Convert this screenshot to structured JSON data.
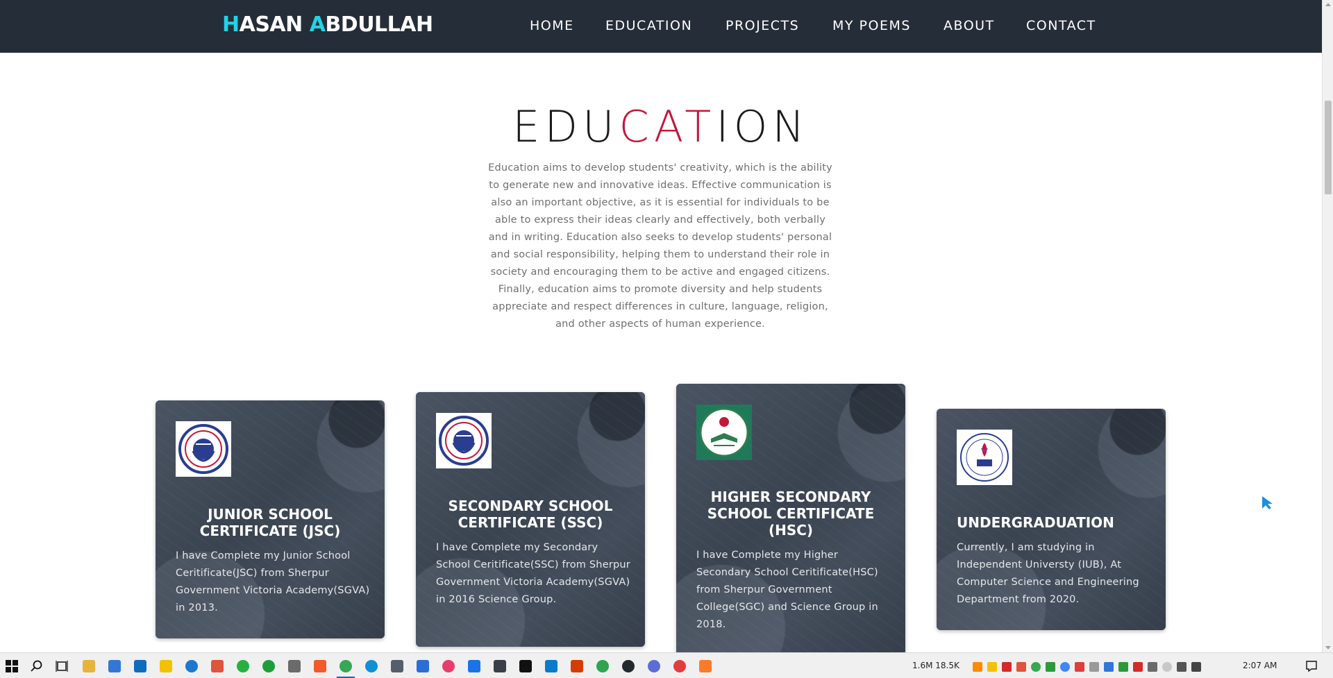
{
  "header": {
    "brand": {
      "initial_1": "H",
      "rest_1": "ASAN ",
      "initial_2": "A",
      "rest_2": "BDULLAH"
    },
    "nav": [
      {
        "label": "HOME"
      },
      {
        "label": "EDUCATION"
      },
      {
        "label": "PROJECTS"
      },
      {
        "label": "MY POEMS"
      },
      {
        "label": "ABOUT"
      },
      {
        "label": "CONTACT"
      }
    ]
  },
  "education": {
    "title_part_1": "EDU",
    "title_accent": "CAT",
    "title_part_2": "ION",
    "description": "Education aims to develop students' creativity, which is the ability to generate new and innovative ideas. Effective communication is also an important objective, as it is essential for individuals to be able to express their ideas clearly and effectively, both verbally and in writing. Education also seeks to develop students' personal and social responsibility, helping them to understand their role in society and encouraging them to be active and engaged citizens. Finally, education aims to promote diversity and help students appreciate and respect differences in culture, language, religion, and other aspects of human experience.",
    "cards": [
      {
        "title": "JUNIOR SCHOOL CERTIFICATE (JSC)",
        "text": "I have Complete my Junior School Ceritificate(JSC) from Sherpur Government Victoria Academy(SGVA) in 2013.",
        "logo": "sgva-school-seal"
      },
      {
        "title": "SECONDARY SCHOOL CERTIFICATE (SSC)",
        "text": "I have Complete my Secondary School Ceritificate(SSC) from Sherpur Government Victoria Academy(SGVA) in 2016 Science Group.",
        "logo": "sgva-school-seal"
      },
      {
        "title": "HIGHER SECONDARY SCHOOL CERTIFICATE (HSC)",
        "text": "I have Complete my Higher Secondary School Ceritificate(HSC) from Sherpur Government College(SGC) and Science Group in 2018.",
        "logo": "sgc-college-seal"
      },
      {
        "title": "UNDERGRADUATION",
        "text": "Currently, I am studying in Independent Universty (IUB), At Computer Science and Engineering Department from 2020.",
        "logo": "iub-seal"
      }
    ]
  },
  "colors": {
    "navbar_bg": "#252d38",
    "brand_accent": "#22d3e6",
    "title_accent": "#c2183a",
    "card_bg": "#3b4553",
    "cursor": "#1a8fe0"
  },
  "taskbar": {
    "apps": [
      "windows-start-icon",
      "search-icon",
      "task-view-icon",
      "file-explorer-icon",
      "store-icon",
      "mail-icon",
      "sticky-notes-icon",
      "messenger-icon",
      "git-icon",
      "whatsapp-icon",
      "whatsapp-icon",
      "calculator-icon",
      "brave-icon",
      "chrome-icon",
      "edge-icon",
      "camera-icon",
      "app-3-icon",
      "music-icon",
      "app-icon",
      "app-icon",
      "pycharm-icon",
      "vscode-icon",
      "office-icon",
      "app-icon",
      "github-icon",
      "app-icon",
      "app-icon",
      "app-icon"
    ],
    "net_speed": "1.6M 18.5K",
    "clock": "2:07 AM"
  }
}
